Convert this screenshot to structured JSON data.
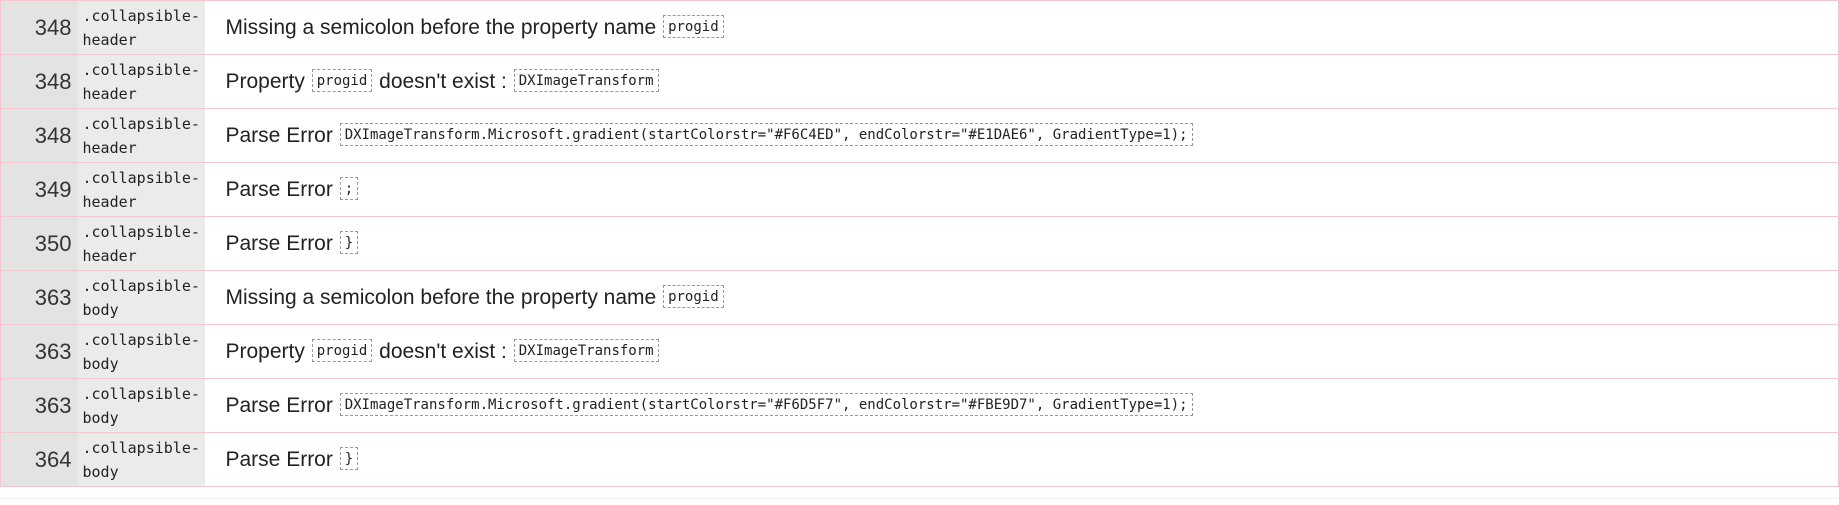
{
  "errors": [
    {
      "line": "348",
      "context": ".collapsible-\nheader",
      "parts": [
        "Missing a semicolon before the property name",
        "progid"
      ]
    },
    {
      "line": "348",
      "context": ".collapsible-\nheader",
      "parts": [
        "Property",
        "progid",
        "doesn't exist :",
        "DXImageTransform"
      ]
    },
    {
      "line": "348",
      "context": ".collapsible-\nheader",
      "parts": [
        "Parse Error",
        "DXImageTransform.Microsoft.gradient(startColorstr=\"#F6C4ED\", endColorstr=\"#E1DAE6\", GradientType=1);"
      ]
    },
    {
      "line": "349",
      "context": ".collapsible-\nheader",
      "parts": [
        "Parse Error",
        ";"
      ]
    },
    {
      "line": "350",
      "context": ".collapsible-\nheader",
      "parts": [
        "Parse Error",
        "}"
      ]
    },
    {
      "line": "363",
      "context": ".collapsible-\nbody",
      "parts": [
        "Missing a semicolon before the property name",
        "progid"
      ]
    },
    {
      "line": "363",
      "context": ".collapsible-\nbody",
      "parts": [
        "Property",
        "progid",
        "doesn't exist :",
        "DXImageTransform"
      ]
    },
    {
      "line": "363",
      "context": ".collapsible-\nbody",
      "parts": [
        "Parse Error",
        "DXImageTransform.Microsoft.gradient(startColorstr=\"#F6D5F7\", endColorstr=\"#FBE9D7\", GradientType=1);"
      ]
    },
    {
      "line": "364",
      "context": ".collapsible-\nbody",
      "parts": [
        "Parse Error",
        "}"
      ]
    }
  ],
  "colors": {
    "row_border": "#f3c7cf",
    "line_cell_bg": "#e3e3e3",
    "context_cell_bg": "#ebebeb"
  }
}
